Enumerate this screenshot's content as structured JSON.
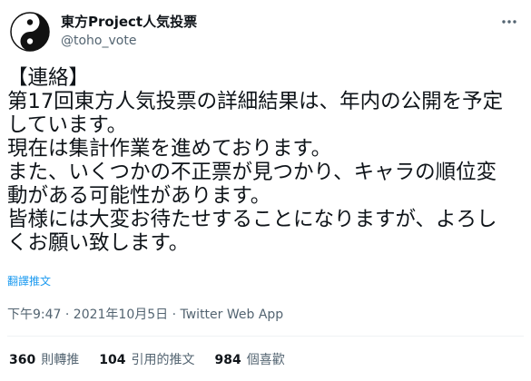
{
  "author": {
    "display_name": "東方Project人気投票",
    "handle": "@toho_vote",
    "avatar_icon": "yin-yang-icon"
  },
  "tweet": {
    "lines": [
      "【連絡】",
      "第17回東方人気投票の詳細結果は、年内の公開を予定",
      "しています。",
      "現在は集計作業を進めております。",
      "また、いくつかの不正票が見つかり、キャラの順位変",
      "動がある可能性があります。",
      "皆様には大変お待たせすることになりますが、よろし",
      "くお願い致します。"
    ],
    "translate_label": "翻譯推文",
    "timestamp": "下午9:47 · 2021年10月5日 · Twitter Web App"
  },
  "stats": {
    "retweets_count": "360",
    "retweets_label": "則轉推",
    "quotes_count": "104",
    "quotes_label": "引用的推文",
    "likes_count": "984",
    "likes_label": "個喜歡"
  },
  "colors": {
    "text": "#0f1419",
    "secondary": "#536471",
    "link": "#1d9bf0"
  },
  "icons": {
    "more": "more-icon"
  }
}
